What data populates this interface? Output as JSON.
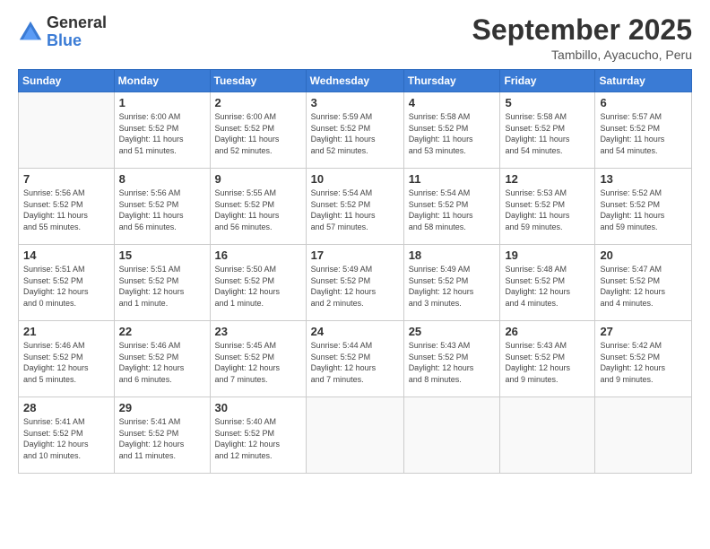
{
  "logo": {
    "general": "General",
    "blue": "Blue"
  },
  "header": {
    "month": "September 2025",
    "location": "Tambillo, Ayacucho, Peru"
  },
  "weekdays": [
    "Sunday",
    "Monday",
    "Tuesday",
    "Wednesday",
    "Thursday",
    "Friday",
    "Saturday"
  ],
  "weeks": [
    [
      {
        "day": "",
        "info": ""
      },
      {
        "day": "1",
        "info": "Sunrise: 6:00 AM\nSunset: 5:52 PM\nDaylight: 11 hours\nand 51 minutes."
      },
      {
        "day": "2",
        "info": "Sunrise: 6:00 AM\nSunset: 5:52 PM\nDaylight: 11 hours\nand 52 minutes."
      },
      {
        "day": "3",
        "info": "Sunrise: 5:59 AM\nSunset: 5:52 PM\nDaylight: 11 hours\nand 52 minutes."
      },
      {
        "day": "4",
        "info": "Sunrise: 5:58 AM\nSunset: 5:52 PM\nDaylight: 11 hours\nand 53 minutes."
      },
      {
        "day": "5",
        "info": "Sunrise: 5:58 AM\nSunset: 5:52 PM\nDaylight: 11 hours\nand 54 minutes."
      },
      {
        "day": "6",
        "info": "Sunrise: 5:57 AM\nSunset: 5:52 PM\nDaylight: 11 hours\nand 54 minutes."
      }
    ],
    [
      {
        "day": "7",
        "info": "Sunrise: 5:56 AM\nSunset: 5:52 PM\nDaylight: 11 hours\nand 55 minutes."
      },
      {
        "day": "8",
        "info": "Sunrise: 5:56 AM\nSunset: 5:52 PM\nDaylight: 11 hours\nand 56 minutes."
      },
      {
        "day": "9",
        "info": "Sunrise: 5:55 AM\nSunset: 5:52 PM\nDaylight: 11 hours\nand 56 minutes."
      },
      {
        "day": "10",
        "info": "Sunrise: 5:54 AM\nSunset: 5:52 PM\nDaylight: 11 hours\nand 57 minutes."
      },
      {
        "day": "11",
        "info": "Sunrise: 5:54 AM\nSunset: 5:52 PM\nDaylight: 11 hours\nand 58 minutes."
      },
      {
        "day": "12",
        "info": "Sunrise: 5:53 AM\nSunset: 5:52 PM\nDaylight: 11 hours\nand 59 minutes."
      },
      {
        "day": "13",
        "info": "Sunrise: 5:52 AM\nSunset: 5:52 PM\nDaylight: 11 hours\nand 59 minutes."
      }
    ],
    [
      {
        "day": "14",
        "info": "Sunrise: 5:51 AM\nSunset: 5:52 PM\nDaylight: 12 hours\nand 0 minutes."
      },
      {
        "day": "15",
        "info": "Sunrise: 5:51 AM\nSunset: 5:52 PM\nDaylight: 12 hours\nand 1 minute."
      },
      {
        "day": "16",
        "info": "Sunrise: 5:50 AM\nSunset: 5:52 PM\nDaylight: 12 hours\nand 1 minute."
      },
      {
        "day": "17",
        "info": "Sunrise: 5:49 AM\nSunset: 5:52 PM\nDaylight: 12 hours\nand 2 minutes."
      },
      {
        "day": "18",
        "info": "Sunrise: 5:49 AM\nSunset: 5:52 PM\nDaylight: 12 hours\nand 3 minutes."
      },
      {
        "day": "19",
        "info": "Sunrise: 5:48 AM\nSunset: 5:52 PM\nDaylight: 12 hours\nand 4 minutes."
      },
      {
        "day": "20",
        "info": "Sunrise: 5:47 AM\nSunset: 5:52 PM\nDaylight: 12 hours\nand 4 minutes."
      }
    ],
    [
      {
        "day": "21",
        "info": "Sunrise: 5:46 AM\nSunset: 5:52 PM\nDaylight: 12 hours\nand 5 minutes."
      },
      {
        "day": "22",
        "info": "Sunrise: 5:46 AM\nSunset: 5:52 PM\nDaylight: 12 hours\nand 6 minutes."
      },
      {
        "day": "23",
        "info": "Sunrise: 5:45 AM\nSunset: 5:52 PM\nDaylight: 12 hours\nand 7 minutes."
      },
      {
        "day": "24",
        "info": "Sunrise: 5:44 AM\nSunset: 5:52 PM\nDaylight: 12 hours\nand 7 minutes."
      },
      {
        "day": "25",
        "info": "Sunrise: 5:43 AM\nSunset: 5:52 PM\nDaylight: 12 hours\nand 8 minutes."
      },
      {
        "day": "26",
        "info": "Sunrise: 5:43 AM\nSunset: 5:52 PM\nDaylight: 12 hours\nand 9 minutes."
      },
      {
        "day": "27",
        "info": "Sunrise: 5:42 AM\nSunset: 5:52 PM\nDaylight: 12 hours\nand 9 minutes."
      }
    ],
    [
      {
        "day": "28",
        "info": "Sunrise: 5:41 AM\nSunset: 5:52 PM\nDaylight: 12 hours\nand 10 minutes."
      },
      {
        "day": "29",
        "info": "Sunrise: 5:41 AM\nSunset: 5:52 PM\nDaylight: 12 hours\nand 11 minutes."
      },
      {
        "day": "30",
        "info": "Sunrise: 5:40 AM\nSunset: 5:52 PM\nDaylight: 12 hours\nand 12 minutes."
      },
      {
        "day": "",
        "info": ""
      },
      {
        "day": "",
        "info": ""
      },
      {
        "day": "",
        "info": ""
      },
      {
        "day": "",
        "info": ""
      }
    ]
  ]
}
